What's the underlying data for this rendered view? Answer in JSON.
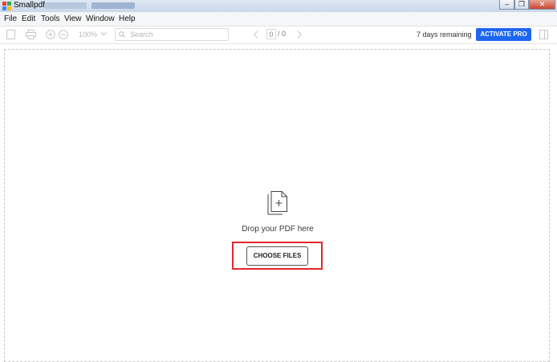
{
  "window": {
    "title": "Smallpdf",
    "minimize_glyph": "–",
    "restore_glyph": "❐",
    "close_glyph": "✕"
  },
  "menu": [
    "File",
    "Edit",
    "Tools",
    "View",
    "Window",
    "Help"
  ],
  "toolbar": {
    "zoom_level": "100%",
    "search_placeholder": "Search",
    "current_page": "0",
    "page_total": "/ 0",
    "trial_text": "7 days remaining",
    "activate_label": "ACTIVATE PRO",
    "accent_color": "#1d66f0",
    "icons": [
      "sidebar-toggle-icon",
      "print-icon",
      "zoom-in-icon",
      "zoom-out-icon",
      "chevron-down-icon",
      "search-icon",
      "chevron-left-icon",
      "chevron-right-icon",
      "panel-icon"
    ]
  },
  "dropzone": {
    "icon": "add-file-icon",
    "message": "Drop your PDF here",
    "button_label": "CHOOSE FILES",
    "highlight_color": "#e0282e"
  }
}
